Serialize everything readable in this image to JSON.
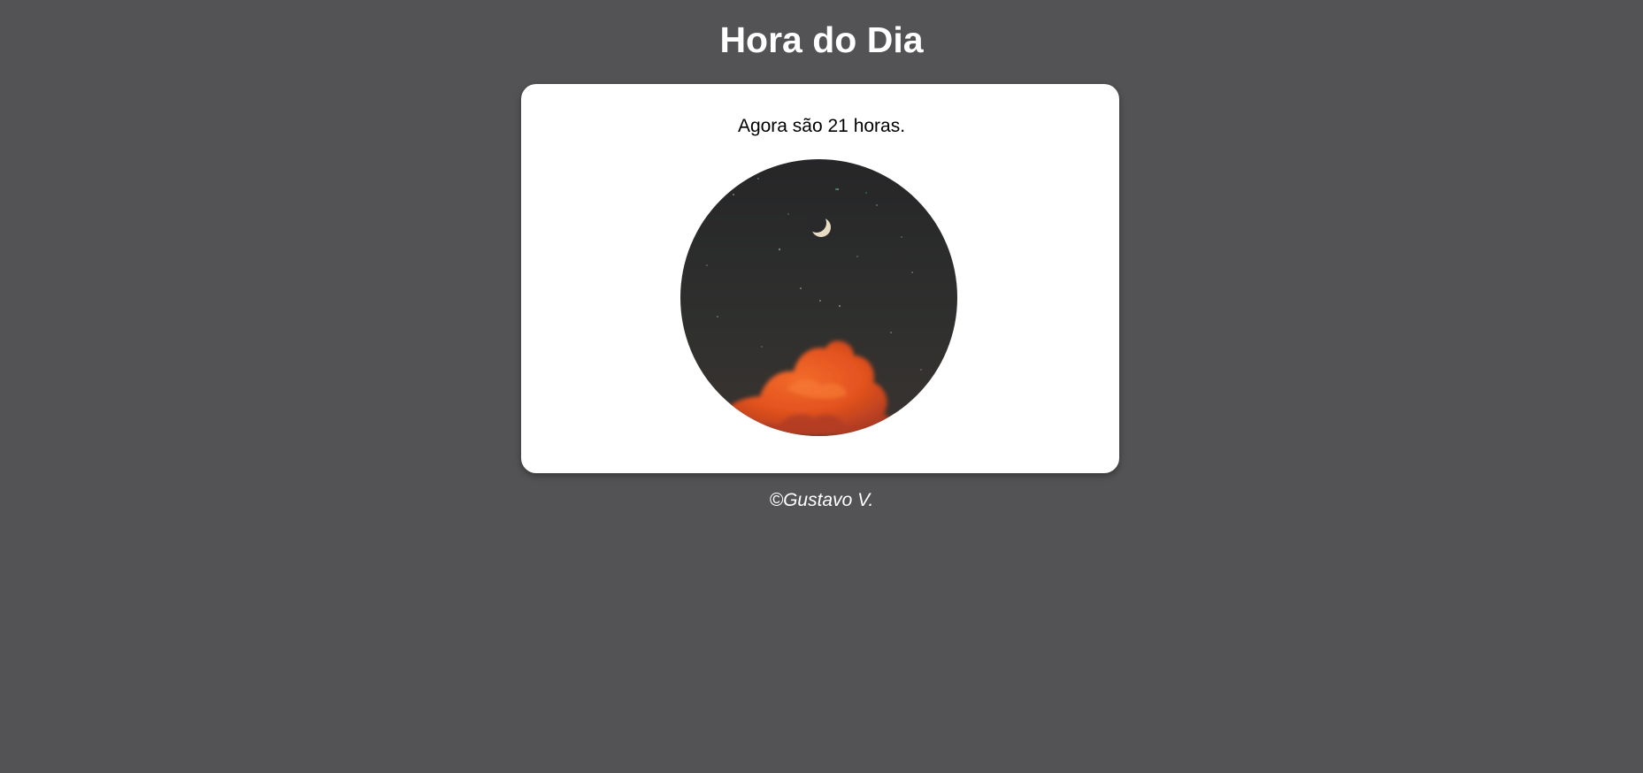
{
  "page": {
    "title": "Hora do Dia",
    "background_color": "#535355"
  },
  "card": {
    "message": "Agora são 21 horas.",
    "image": {
      "icon": "night-sky-image",
      "description_colors": {
        "sky": "#2b2b2d",
        "cloud": "#e8501f"
      }
    }
  },
  "footer": {
    "text": "©Gustavo V."
  }
}
